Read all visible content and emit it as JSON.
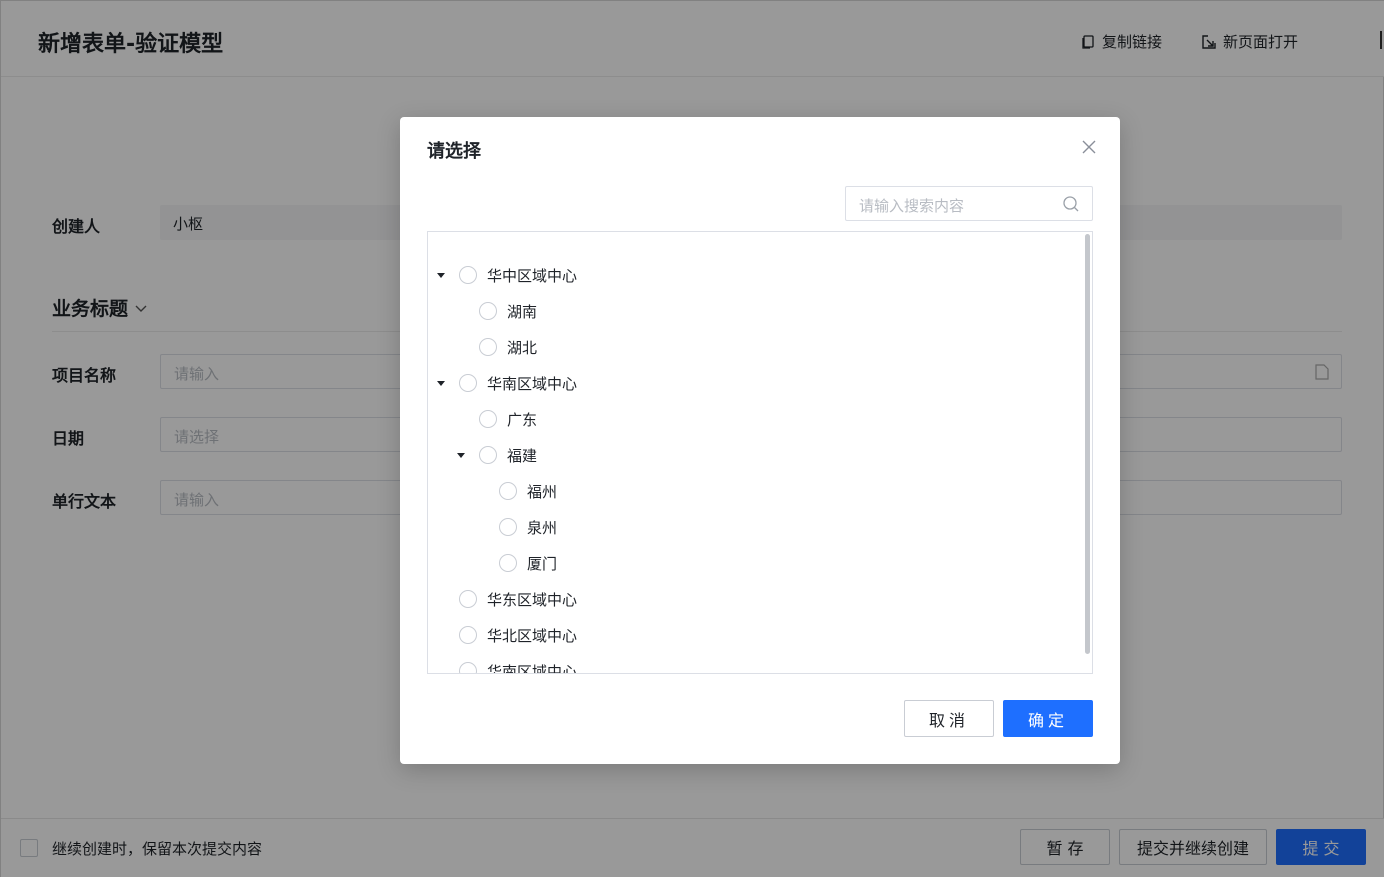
{
  "header": {
    "title": "新增表单-验证模型",
    "copy_link": "复制链接",
    "open_new_page": "新页面打开"
  },
  "form": {
    "creator_label": "创建人",
    "creator_value": "小枢",
    "section_title": "业务标题",
    "project_label": "项目名称",
    "project_placeholder": "请输入",
    "date_label": "日期",
    "date_placeholder": "请选择",
    "text_label": "单行文本",
    "text_placeholder": "请输入"
  },
  "footer": {
    "keep_label": "继续创建时，保留本次提交内容",
    "save_label": "暂 存",
    "submit_continue_label": "提交并继续创建",
    "submit_label": "提 交"
  },
  "modal": {
    "title": "请选择",
    "search_placeholder": "请输入搜索内容",
    "tree": [
      {
        "label": "华中区域中心",
        "level": 0,
        "expanded": true
      },
      {
        "label": "湖南",
        "level": 1
      },
      {
        "label": "湖北",
        "level": 1
      },
      {
        "label": "华南区域中心",
        "level": 0,
        "expanded": true
      },
      {
        "label": "广东",
        "level": 1
      },
      {
        "label": "福建",
        "level": 1,
        "expanded": true
      },
      {
        "label": "福州",
        "level": 2
      },
      {
        "label": "泉州",
        "level": 2
      },
      {
        "label": "厦门",
        "level": 2
      },
      {
        "label": "华东区域中心",
        "level": 0
      },
      {
        "label": "华北区域中心",
        "level": 0
      },
      {
        "label": "华南区域中心",
        "level": 0
      }
    ],
    "cancel_label": "取消",
    "ok_label": "确定"
  }
}
